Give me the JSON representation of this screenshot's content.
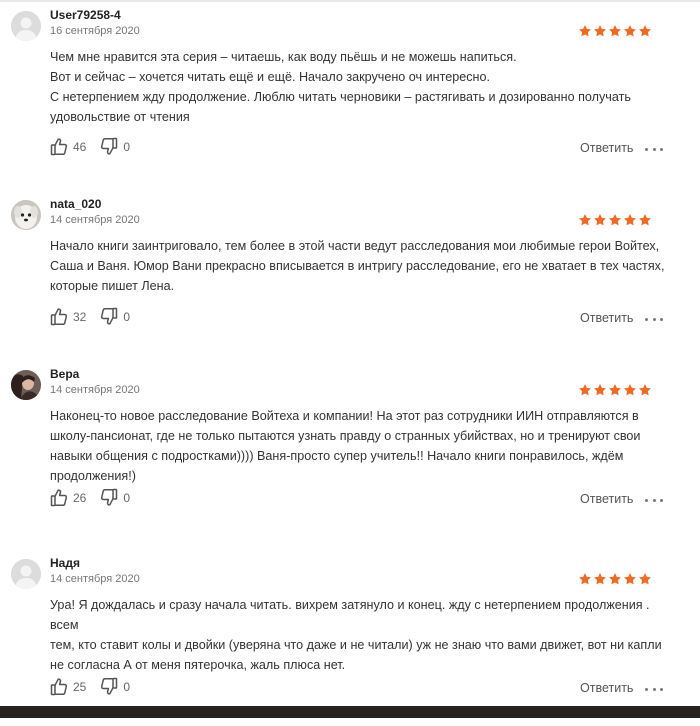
{
  "colors": {
    "star": "#f06a22",
    "text": "#333333",
    "muted": "#777777"
  },
  "reviews": [
    {
      "avatar": "default-user-avatar",
      "name": "User79258-4",
      "date": "16 сентября 2020",
      "rating": 5,
      "lines": [
        "Чем мне нравится эта серия – читаешь, как воду пьёшь и не можешь напиться.",
        "Вот и сейчас – хочется читать ещё и ещё. Начало закручено оч интересно.",
        "С нетерпением жду продолжение. Люблю читать черновики – растягивать и дозированно получать",
        "удовольствие от чтения"
      ],
      "likes": "46",
      "dislikes": "0",
      "reply_label": "Ответить"
    },
    {
      "avatar": "dog-avatar",
      "name": "nata_020",
      "date": "14 сентября 2020",
      "rating": 5,
      "lines": [
        "Начало книги заинтриговало, тем более в этой части ведут расследования мои любимые герои Войтех,",
        "Саша и Ваня. Юмор Вани прекрасно вписывается в интригу расследование, его не хватает в тех частях,",
        "которые пишет Лена."
      ],
      "likes": "32",
      "dislikes": "0",
      "reply_label": "Ответить"
    },
    {
      "avatar": "photo-avatar",
      "name": "Вера",
      "date": "14 сентября 2020",
      "rating": 5,
      "lines": [
        "Наконец-то новое расследование Войтеха и компании! На этот раз сотрудники ИИН отправляются в",
        "школу-пансионат, где не только пытаются узнать правду о странных убийствах, но и тренируют свои",
        "навыки общения с подростками)))) Ваня-просто супер учитель!! Начало книги понравилось, ждём",
        "продолжения!)"
      ],
      "likes": "26",
      "dislikes": "0",
      "reply_label": "Ответить"
    },
    {
      "avatar": "default-user-avatar",
      "name": "Надя",
      "date": "14 сентября 2020",
      "rating": 5,
      "lines": [
        "Ура! Я дождалась и сразу начала читать. вихрем затянуло и конец. жду с нетерпением продолжения .",
        "всем",
        "тем, кто ставит колы и двойки (уверяна что даже и не читали) уж не знаю что вами движет, вот ни капли",
        "не согласна А от меня пятерочка, жаль плюса нет."
      ],
      "likes": "25",
      "dislikes": "0",
      "reply_label": "Ответить"
    }
  ]
}
